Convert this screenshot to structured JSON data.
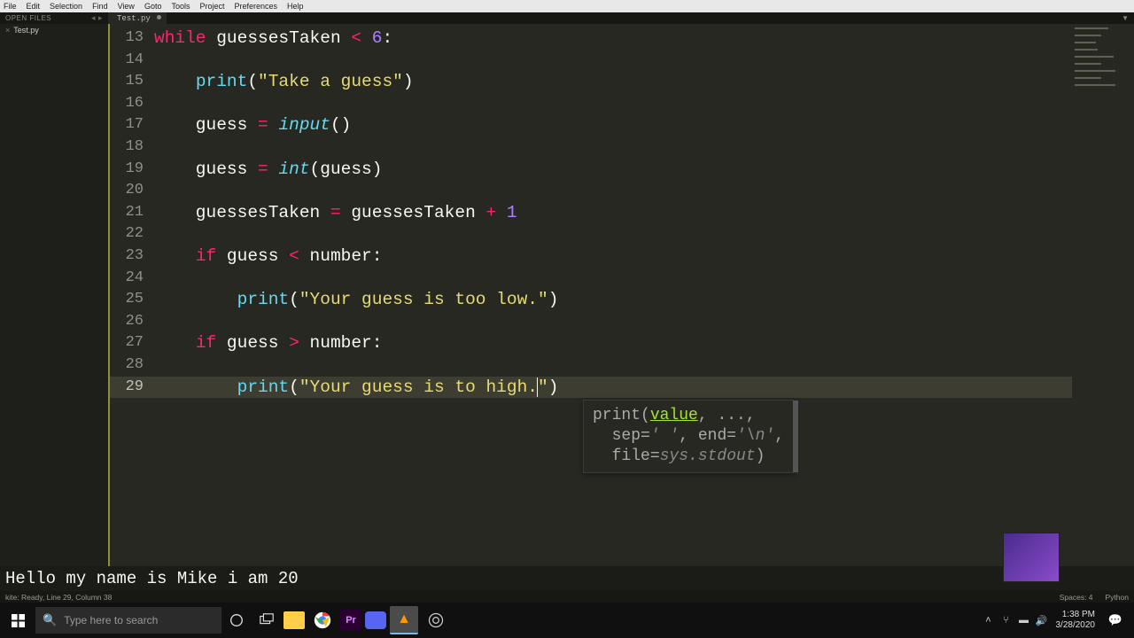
{
  "menu": [
    "File",
    "Edit",
    "Selection",
    "Find",
    "View",
    "Goto",
    "Tools",
    "Project",
    "Preferences",
    "Help"
  ],
  "side_header": "OPEN FILES",
  "open_file": "Test.py",
  "tab_file": "Test.py",
  "code": {
    "start": 13,
    "active": 29,
    "lines": [
      {
        "n": 13,
        "tokens": [
          [
            "kw",
            "while"
          ],
          [
            "id",
            " guessesTaken "
          ],
          [
            "op",
            "<"
          ],
          [
            "id",
            " "
          ],
          [
            "num",
            "6"
          ],
          [
            "pn",
            ":"
          ]
        ]
      },
      {
        "n": 14,
        "tokens": []
      },
      {
        "n": 15,
        "tokens": [
          [
            "id",
            "    "
          ],
          [
            "call",
            "print"
          ],
          [
            "pn",
            "("
          ],
          [
            "str",
            "\"Take a guess\""
          ],
          [
            "pn",
            ")"
          ]
        ]
      },
      {
        "n": 16,
        "tokens": []
      },
      {
        "n": 17,
        "tokens": [
          [
            "id",
            "    guess "
          ],
          [
            "op",
            "="
          ],
          [
            "id",
            " "
          ],
          [
            "fn",
            "input"
          ],
          [
            "pn",
            "()"
          ]
        ]
      },
      {
        "n": 18,
        "tokens": []
      },
      {
        "n": 19,
        "tokens": [
          [
            "id",
            "    guess "
          ],
          [
            "op",
            "="
          ],
          [
            "id",
            " "
          ],
          [
            "fn",
            "int"
          ],
          [
            "pn",
            "("
          ],
          [
            "id",
            "guess"
          ],
          [
            "pn",
            ")"
          ]
        ]
      },
      {
        "n": 20,
        "tokens": []
      },
      {
        "n": 21,
        "tokens": [
          [
            "id",
            "    guessesTaken "
          ],
          [
            "op",
            "="
          ],
          [
            "id",
            " guessesTaken "
          ],
          [
            "op",
            "+"
          ],
          [
            "id",
            " "
          ],
          [
            "num",
            "1"
          ]
        ]
      },
      {
        "n": 22,
        "tokens": []
      },
      {
        "n": 23,
        "tokens": [
          [
            "id",
            "    "
          ],
          [
            "kw",
            "if"
          ],
          [
            "id",
            " guess "
          ],
          [
            "op",
            "<"
          ],
          [
            "id",
            " number"
          ],
          [
            "pn",
            ":"
          ]
        ]
      },
      {
        "n": 24,
        "tokens": []
      },
      {
        "n": 25,
        "tokens": [
          [
            "id",
            "        "
          ],
          [
            "call",
            "print"
          ],
          [
            "pn",
            "("
          ],
          [
            "str",
            "\"Your guess is too low.\""
          ],
          [
            "pn",
            ")"
          ]
        ]
      },
      {
        "n": 26,
        "tokens": []
      },
      {
        "n": 27,
        "tokens": [
          [
            "id",
            "    "
          ],
          [
            "kw",
            "if"
          ],
          [
            "id",
            " guess "
          ],
          [
            "op",
            ">"
          ],
          [
            "id",
            " number"
          ],
          [
            "pn",
            ":"
          ]
        ]
      },
      {
        "n": 28,
        "tokens": []
      },
      {
        "n": 29,
        "tokens": [
          [
            "id",
            "        "
          ],
          [
            "call",
            "print"
          ],
          [
            "pn",
            "("
          ],
          [
            "str",
            "\"Your guess is to high."
          ],
          [
            "cursor",
            ""
          ],
          [
            "str",
            "\""
          ],
          [
            "pn",
            ")"
          ]
        ]
      }
    ]
  },
  "tooltip": {
    "fn": "print",
    "param": "value",
    "rest1": ", ...,",
    "line2a": "sep=",
    "line2b": "' '",
    "line2c": ", end=",
    "line2d": "'\\n'",
    "line2e": ",",
    "line3a": "file=",
    "line3b": "sys.stdout",
    "line3c": ")"
  },
  "console": "Hello my name is Mike i am 20",
  "status": {
    "left": "kite: Ready, Line 29, Column 38",
    "spaces": "Spaces: 4",
    "lang": "Python"
  },
  "taskbar": {
    "search_placeholder": "Type here to search",
    "time": "1:38 PM",
    "date": "3/28/2020"
  }
}
